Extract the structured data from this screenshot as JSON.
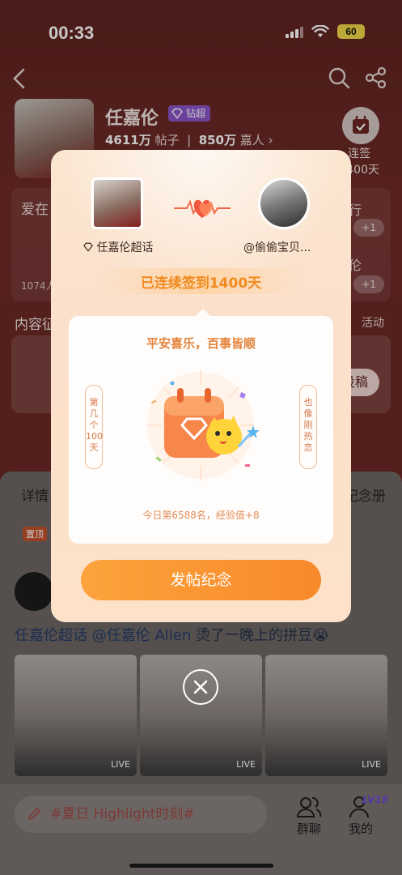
{
  "status_bar": {
    "time": "00:33",
    "battery": "60"
  },
  "profile": {
    "name": "任嘉伦",
    "badge": "钻超",
    "posts_count": "4611万",
    "posts_label": "帖子",
    "fans_count": "850万",
    "fans_label": "嘉人",
    "checkin_label_1": "连签",
    "checkin_label_2": "1400天"
  },
  "background": {
    "card_left_title": "爱在",
    "card_right_title": "行",
    "card_right_title_2": "伦",
    "plus_1": "+1",
    "plus_2": "+1",
    "member_count": "1074人",
    "section_title": "内容征",
    "section_right": "活动",
    "post_button": "投稿",
    "feed_tab_left": "详情",
    "feed_tab_right": "纪念册",
    "pinned": "置顶",
    "post_topic": "任嘉伦超话",
    "post_mention": "@任嘉伦 Allen",
    "post_text": "烫了一晚上的拼豆😭",
    "live_label": "LIVE",
    "compose_placeholder": "#夏日 Highlight时刻#",
    "bottom_group_chat": "群聊",
    "bottom_me": "我的",
    "level_badge": "LV18"
  },
  "popup": {
    "left_name": "任嘉伦超话",
    "right_name": "@偷偷宝贝...",
    "streak_text": "已连续签到1400天",
    "blessing": "平安喜乐，百事皆顺",
    "couplet_left": "第几个100天",
    "couplet_right": "也像刚热恋",
    "rank_text": "今日第6588名，经验值+8",
    "button_label": "发帖纪念"
  },
  "colors": {
    "accent_orange": "#f7892a",
    "background_red": "#6b2622",
    "diamond_purple": "#8b54c8"
  }
}
